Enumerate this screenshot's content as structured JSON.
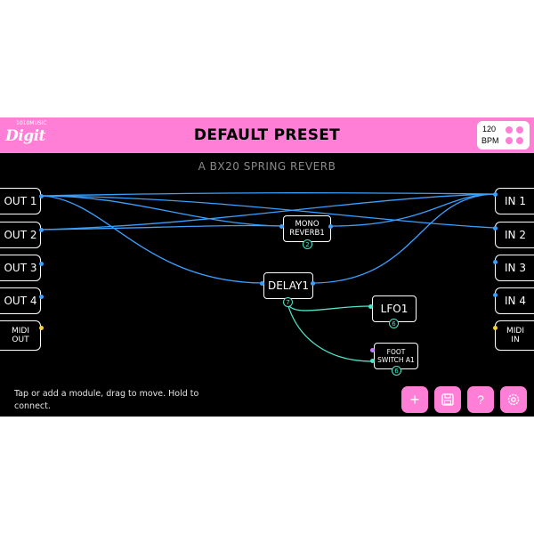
{
  "app": {
    "logo_small": "1010MUSIC",
    "logo": "Digit",
    "preset_title": "DEFAULT PRESET",
    "bpm_value": "120",
    "bpm_unit": "BPM",
    "subtitle": "A BX20 SPRING REVERB"
  },
  "inputs_left": [
    {
      "label": "OUT 1",
      "port_color": "#3aa0ff"
    },
    {
      "label": "OUT 2",
      "port_color": "#3aa0ff"
    },
    {
      "label": "OUT 3",
      "port_color": "#3aa0ff"
    },
    {
      "label": "OUT 4",
      "port_color": "#3aa0ff"
    },
    {
      "label_line1": "MIDI",
      "label_line2": "OUT",
      "port_color": "#f5d142"
    }
  ],
  "inputs_right": [
    {
      "label": "IN 1",
      "port_color": "#3aa0ff"
    },
    {
      "label": "IN 2",
      "port_color": "#3aa0ff"
    },
    {
      "label": "IN 3",
      "port_color": "#3aa0ff"
    },
    {
      "label": "IN 4",
      "port_color": "#3aa0ff"
    },
    {
      "label_line1": "MIDI",
      "label_line2": "IN",
      "port_color": "#f5d142"
    }
  ],
  "modules": {
    "mono_reverb": {
      "line1": "MONO",
      "line2": "REVERB1",
      "badge": "2"
    },
    "delay": {
      "label": "DELAY1",
      "badge": "7"
    },
    "lfo": {
      "label": "LFO1",
      "badge": "6"
    },
    "foot_switch": {
      "line1": "FOOT",
      "line2": "SWITCH A1",
      "badge": "6"
    }
  },
  "footer": {
    "hint": "Tap or add a module, drag to move. Hold to connect.",
    "buttons": [
      {
        "icon": "plus-icon",
        "glyph": "+"
      },
      {
        "icon": "save-icon",
        "glyph": "💾"
      },
      {
        "icon": "help-icon",
        "glyph": "?"
      },
      {
        "icon": "settings-icon",
        "glyph": "⚙"
      }
    ]
  },
  "colors": {
    "accent": "#ff7fd6",
    "audio_wire": "#3aa0ff",
    "cv_wire": "#4fe3c6",
    "midi_port": "#f5d142",
    "background": "#000000"
  }
}
